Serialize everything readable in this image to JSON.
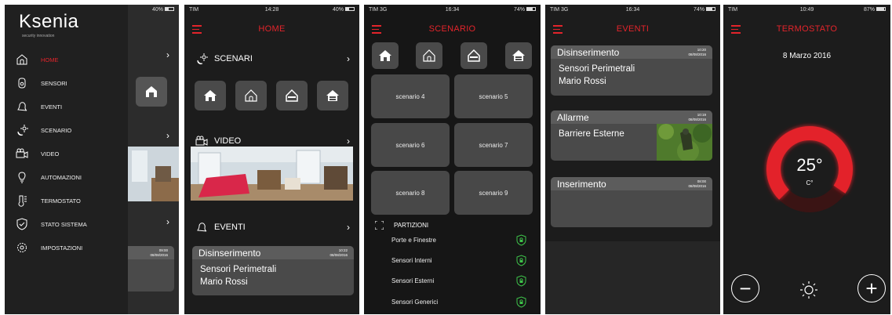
{
  "screen1": {
    "status": {
      "right": "40%"
    },
    "logo": {
      "brand": "Ksenia",
      "tagline": "security innovation"
    },
    "menu": [
      {
        "label": "HOME",
        "icon": "house-outline-icon",
        "active": true
      },
      {
        "label": "SENSORI",
        "icon": "sensor-icon"
      },
      {
        "label": "EVENTI",
        "icon": "bell-icon"
      },
      {
        "label": "SCENARIO",
        "icon": "moon-sun-icon"
      },
      {
        "label": "VIDEO",
        "icon": "video-camera-icon"
      },
      {
        "label": "AUTOMAZIONI",
        "icon": "bulb-icon"
      },
      {
        "label": "TERMOSTATO",
        "icon": "thermometer-icon"
      },
      {
        "label": "STATO SISTEMA",
        "icon": "shield-check-icon"
      },
      {
        "label": "IMPOSTAZIONI",
        "icon": "gear-icon"
      }
    ],
    "peek_card": {
      "time": "09:00",
      "date": "08/08/2016"
    }
  },
  "screen2": {
    "status": {
      "left": "TIM",
      "center": "14:28",
      "right": "40%"
    },
    "title": "HOME",
    "sections": {
      "scenari": "SCENARI",
      "video": "VIDEO",
      "eventi": "EVENTI"
    },
    "event_card": {
      "title": "Disinserimento",
      "time": "10:22",
      "date": "08/08/2016",
      "line1": "Sensori Perimetrali",
      "line2": "Mario Rossi"
    }
  },
  "screen3": {
    "status": {
      "left": "TIM  3G",
      "center": "16:34",
      "right": "74%"
    },
    "title": "SCENARIO",
    "scenarios": [
      "scenario 4",
      "scenario 5",
      "scenario 6",
      "scenario 7",
      "scenario 8",
      "scenario 9"
    ],
    "partitions_title": "PARTIZIONI",
    "partitions": [
      "Porte e Finestre",
      "Sensori Interni",
      "Sensori Esterni",
      "Sensori Generici"
    ]
  },
  "screen4": {
    "status": {
      "left": "TIM  3G",
      "center": "16:34",
      "right": "74%"
    },
    "title": "EVENTI",
    "events": [
      {
        "title": "Disinserimento",
        "time": "10:20",
        "date": "08/08/2016",
        "line1": "Sensori Perimetrali",
        "line2": "Mario Rossi"
      },
      {
        "title": "Allarme",
        "time": "10:19",
        "date": "08/08/2016",
        "line1": "Barriere Esterne",
        "line2": ""
      },
      {
        "title": "Inserimento",
        "time": "08:00",
        "date": "08/08/2016",
        "line1": "",
        "line2": ""
      }
    ]
  },
  "screen5": {
    "status": {
      "left": "TIM",
      "center": "10:49",
      "right": "87%"
    },
    "title": "TERMOSTATO",
    "date": "8 Marzo 2016",
    "temperature": "25°",
    "unit": "C°",
    "gauge_fraction": 0.72,
    "minus": "−",
    "plus": "+"
  },
  "colors": {
    "accent": "#e3242b",
    "tile": "#4a4a4a",
    "background": "#1c1c1c"
  }
}
